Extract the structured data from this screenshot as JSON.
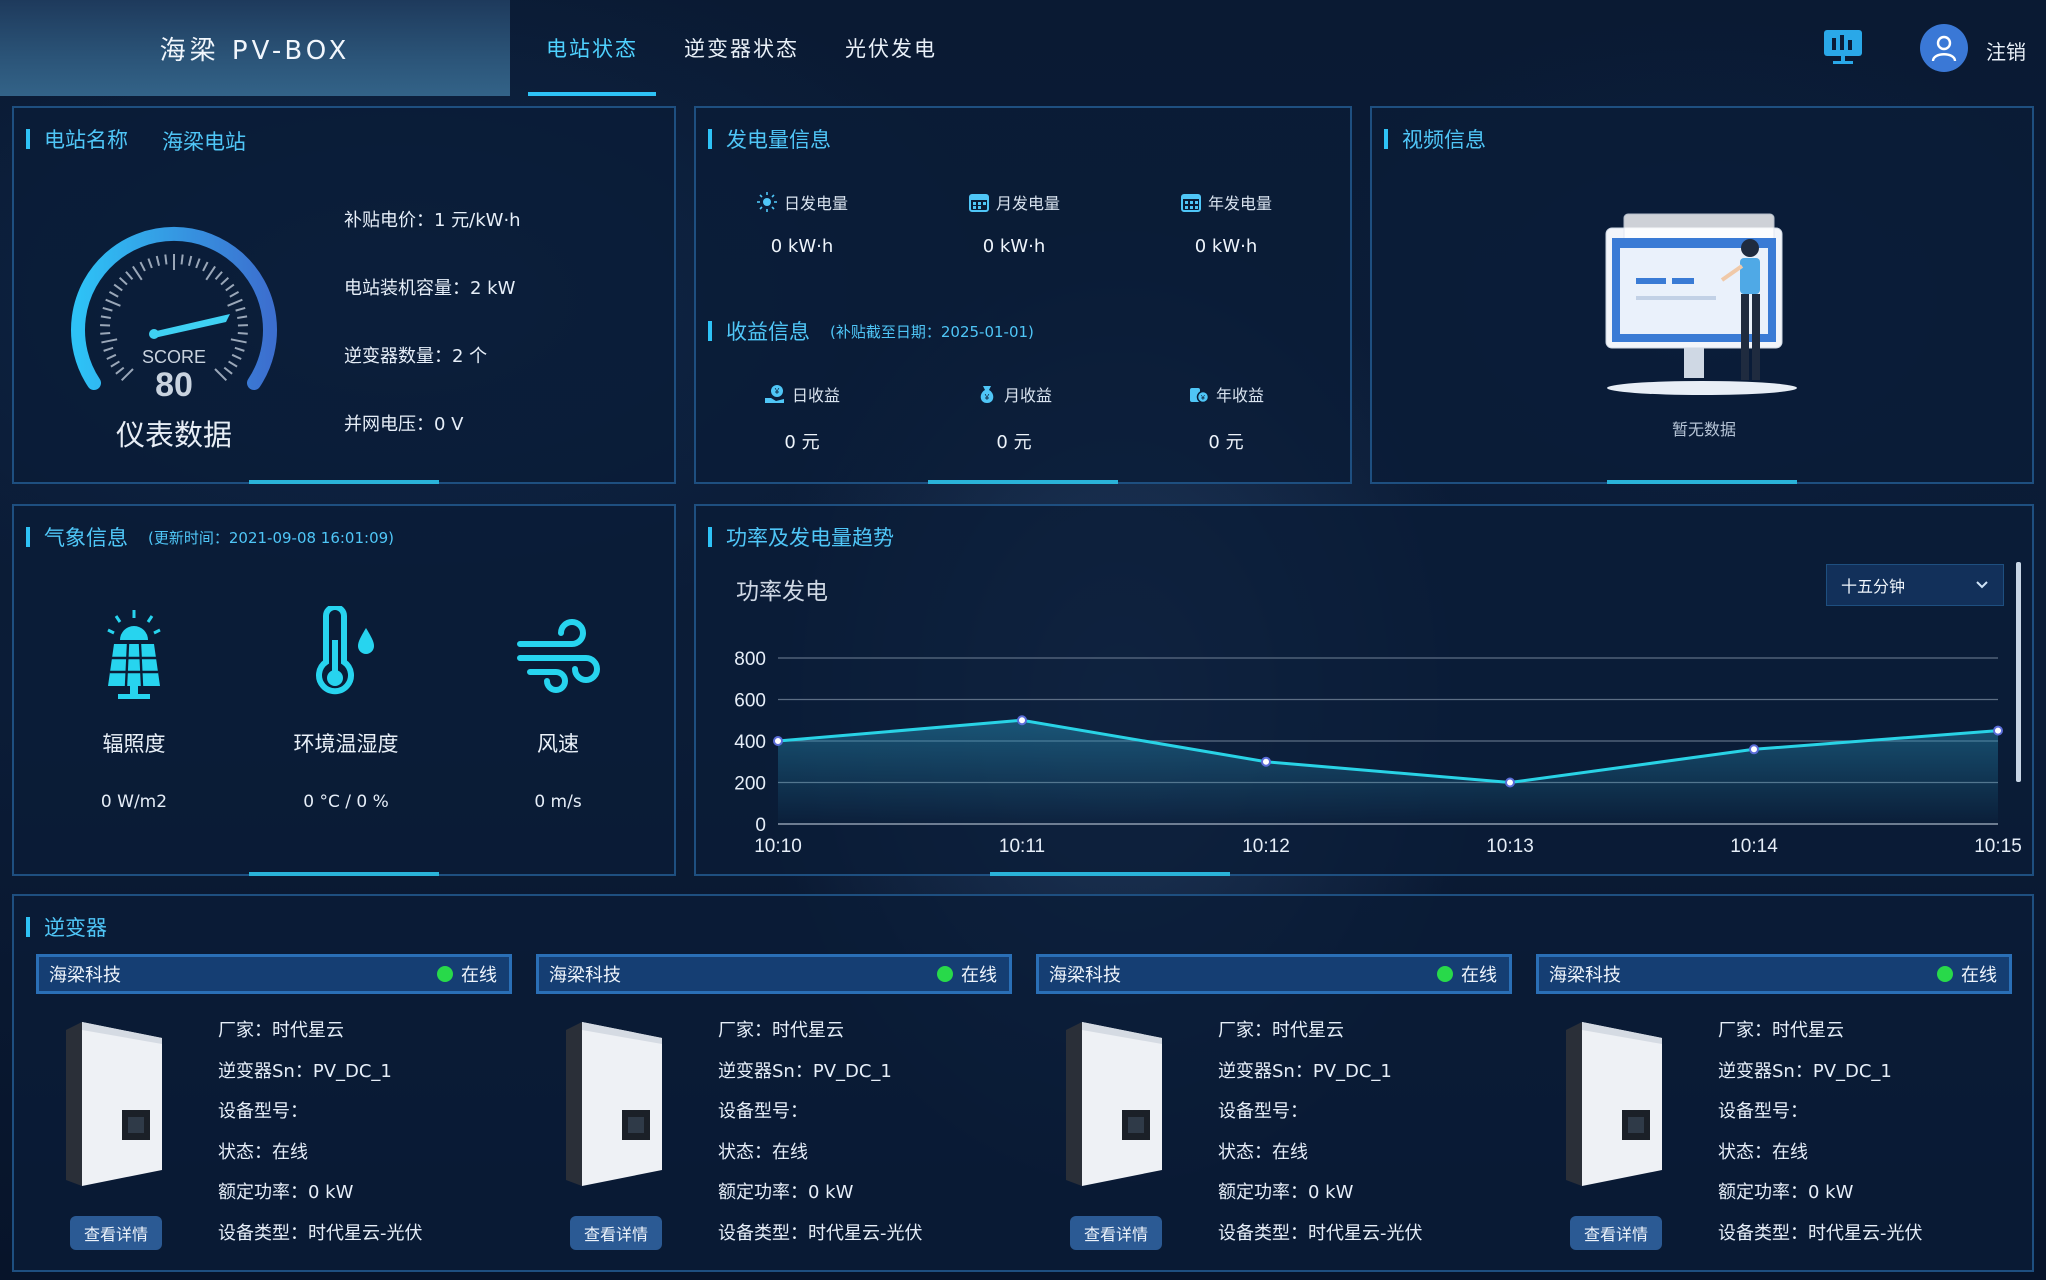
{
  "header": {
    "app_title": "海梁 PV-BOX",
    "tabs": [
      {
        "label": "电站状态",
        "active": true
      },
      {
        "label": "逆变器状态",
        "active": false
      },
      {
        "label": "光伏发电",
        "active": false
      }
    ],
    "logout_label": "注销",
    "monitor_icon": "monitor-icon",
    "avatar_icon": "user-avatar-icon"
  },
  "station": {
    "title": "电站名称",
    "name": "海梁电站",
    "gauge": {
      "score_label": "SCORE",
      "score_value": "80",
      "caption": "仪表数据",
      "level": 0.8
    },
    "info": [
      "补贴电价：1 元/kW·h",
      "电站装机容量：2 kW",
      "逆变器数量：2 个",
      "并网电压：0 V"
    ]
  },
  "generation": {
    "title": "发电量信息",
    "items": [
      {
        "icon": "sun-icon",
        "label": "日发电量",
        "value": "0 kW·h"
      },
      {
        "icon": "calendar-icon",
        "label": "月发电量",
        "value": "0 kW·h"
      },
      {
        "icon": "calendar-grid-icon",
        "label": "年发电量",
        "value": "0 kW·h"
      }
    ],
    "revenue_title": "收益信息",
    "revenue_note": "(补贴截至日期：2025-01-01)",
    "revenue_items": [
      {
        "icon": "hand-coin-icon",
        "label": "日收益",
        "value": "0 元"
      },
      {
        "icon": "money-bag-icon",
        "label": "月收益",
        "value": "0 元"
      },
      {
        "icon": "coins-icon",
        "label": "年收益",
        "value": "0 元"
      }
    ]
  },
  "video": {
    "title": "视频信息",
    "empty_text": "暂无数据"
  },
  "weather": {
    "title": "气象信息",
    "updated": "(更新时间：2021-09-08 16:01:09)",
    "items": [
      {
        "icon": "solar-panel-icon",
        "label": "辐照度",
        "value": "0 W/m2"
      },
      {
        "icon": "thermometer-icon",
        "label": "环境温湿度",
        "value": "0 °C / 0 %"
      },
      {
        "icon": "wind-icon",
        "label": "风速",
        "value": "0 m/s"
      }
    ]
  },
  "power": {
    "title": "功率及发电量趋势",
    "chart_title": "功率发电",
    "interval_select": "十五分钟"
  },
  "chart_data": {
    "type": "area",
    "title": "功率发电",
    "x": [
      "10:10",
      "10:11",
      "10:12",
      "10:13",
      "10:14",
      "10:15"
    ],
    "series": [
      {
        "values": [
          400,
          500,
          300,
          200,
          360,
          450
        ]
      }
    ],
    "ylim": [
      0,
      800
    ],
    "yticks": [
      0,
      200,
      400,
      600,
      800
    ],
    "grid": true,
    "colors": {
      "line": "#29d3e6",
      "fill_top": "rgba(41,150,190,0.45)",
      "fill_bottom": "rgba(41,150,190,0.02)"
    }
  },
  "inverters": {
    "title": "逆变器",
    "detail_button": "查看详情",
    "cards": [
      {
        "brand": "海梁科技",
        "status": "在线",
        "vendor": "厂家：时代星云",
        "sn": "逆变器Sn：PV_DC_1",
        "model": "设备型号：",
        "state": "状态：在线",
        "rated": "额定功率：0 kW",
        "type": "设备类型：时代星云-光伏"
      },
      {
        "brand": "海梁科技",
        "status": "在线",
        "vendor": "厂家：时代星云",
        "sn": "逆变器Sn：PV_DC_1",
        "model": "设备型号：",
        "state": "状态：在线",
        "rated": "额定功率：0 kW",
        "type": "设备类型：时代星云-光伏"
      },
      {
        "brand": "海梁科技",
        "status": "在线",
        "vendor": "厂家：时代星云",
        "sn": "逆变器Sn：PV_DC_1",
        "model": "设备型号：",
        "state": "状态：在线",
        "rated": "额定功率：0 kW",
        "type": "设备类型：时代星云-光伏"
      },
      {
        "brand": "海梁科技",
        "status": "在线",
        "vendor": "厂家：时代星云",
        "sn": "逆变器Sn：PV_DC_1",
        "model": "设备型号：",
        "state": "状态：在线",
        "rated": "额定功率：0 kW",
        "type": "设备类型：时代星云-光伏"
      }
    ]
  },
  "colors": {
    "accent": "#2ec2f6",
    "title": "#4fc6f7",
    "online": "#28d94a",
    "panel_border": "#1e4f80"
  }
}
